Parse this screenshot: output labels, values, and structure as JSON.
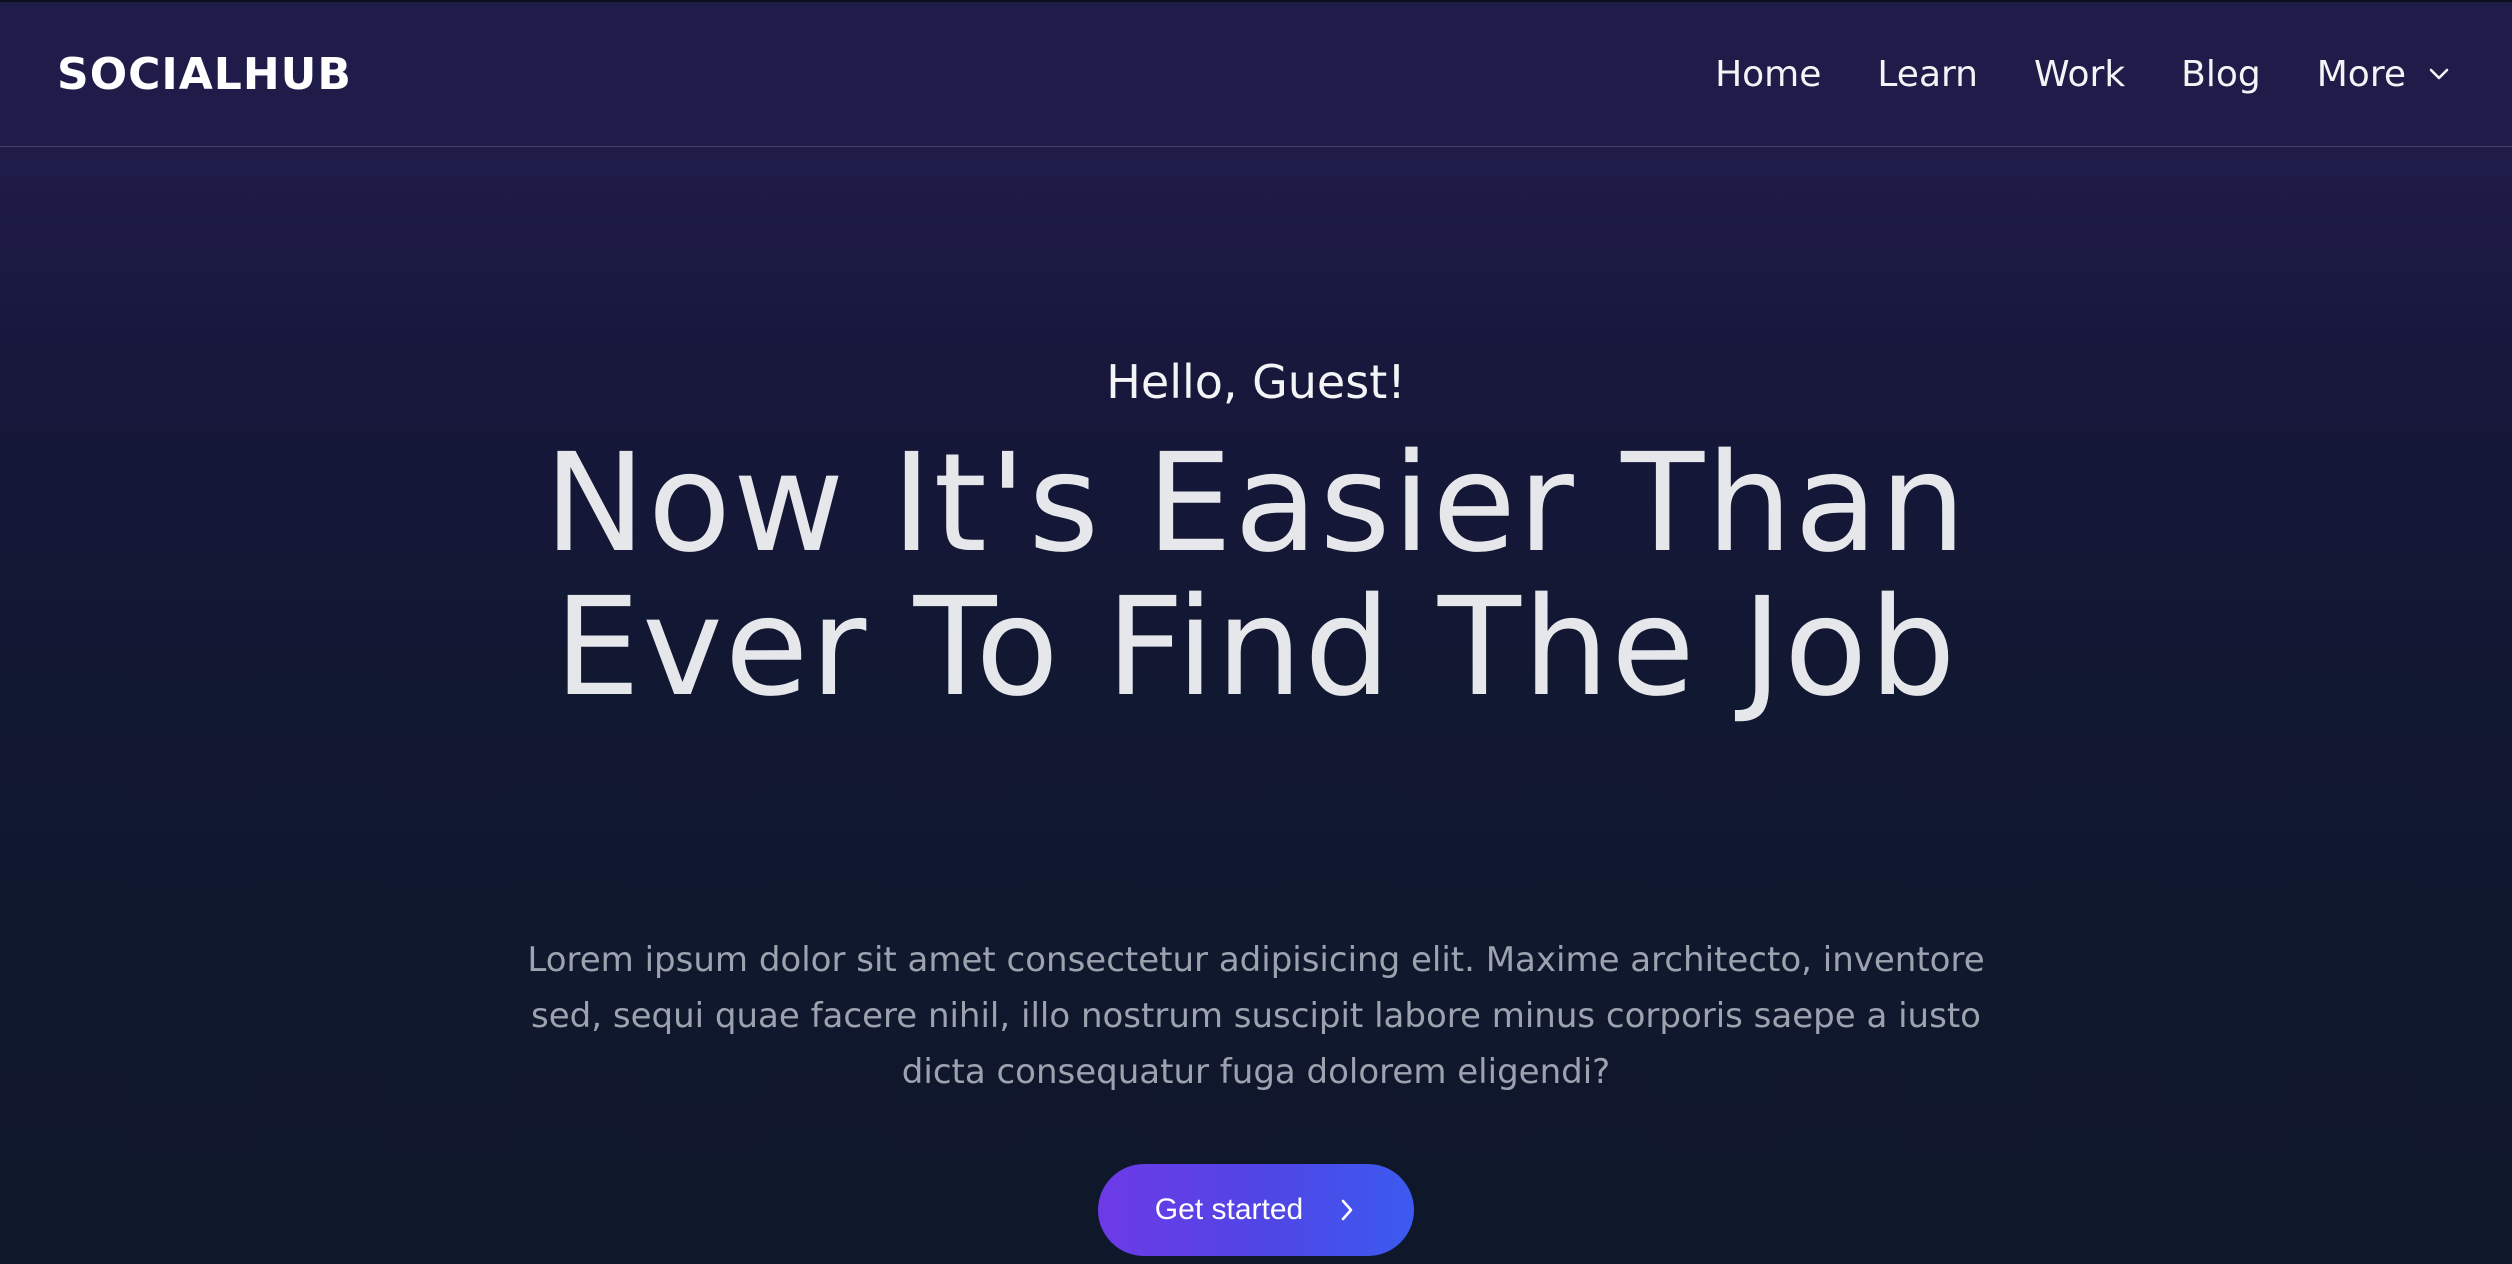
{
  "header": {
    "brand": "SOCIALHUB",
    "nav": [
      {
        "label": "Home"
      },
      {
        "label": "Learn"
      },
      {
        "label": "Work"
      },
      {
        "label": "Blog"
      },
      {
        "label": "More",
        "icon": "chevron-down-icon"
      }
    ]
  },
  "hero": {
    "greeting": "Hello, Guest!",
    "headline_line1": "Now It's Easier Than",
    "headline_line2": "Ever To Find The Job",
    "description": "Lorem ipsum dolor sit amet consectetur adipisicing elit. Maxime architecto, inventore sed, sequi quae facere nihil, illo nostrum suscipit labore minus corporis saepe a iusto dicta consequatur fuga dolorem eligendi?",
    "cta_label": "Get started",
    "cta_icon": "chevron-right-icon"
  },
  "colors": {
    "background_top": "#1f1c49",
    "background_bottom": "#0f172a",
    "cta_gradient_start": "#6d3ae6",
    "cta_gradient_end": "#3b5bf0",
    "description_text": "#9ca3af"
  }
}
